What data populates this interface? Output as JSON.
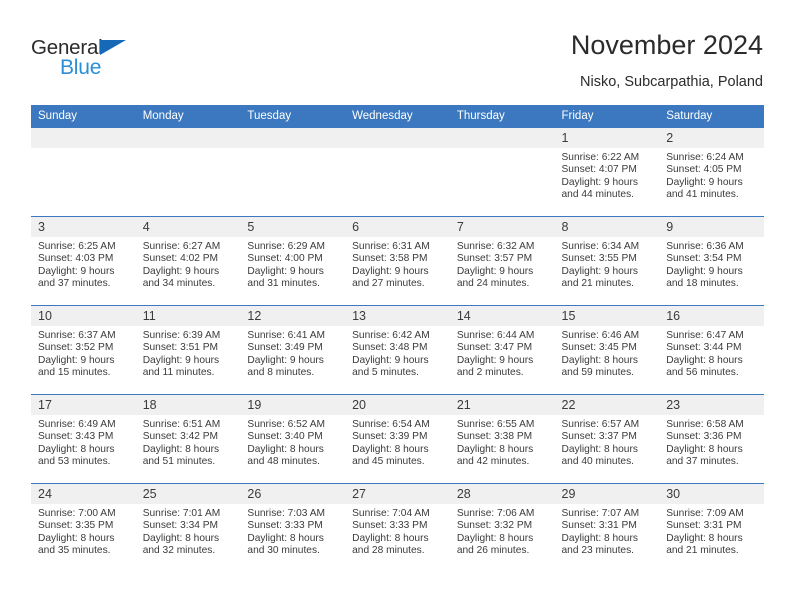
{
  "brand": {
    "word_general": "General",
    "word_blue": "Blue",
    "accent_blue": "#3b78bf",
    "logo_blue": "#2a8fd6",
    "triangle_blue": "#1669b7"
  },
  "header": {
    "title": "November 2024",
    "location": "Nisko, Subcarpathia, Poland"
  },
  "weekday_headers": [
    "Sunday",
    "Monday",
    "Tuesday",
    "Wednesday",
    "Thursday",
    "Friday",
    "Saturday"
  ],
  "weeks": [
    [
      {
        "day": "",
        "lines": []
      },
      {
        "day": "",
        "lines": []
      },
      {
        "day": "",
        "lines": []
      },
      {
        "day": "",
        "lines": []
      },
      {
        "day": "",
        "lines": []
      },
      {
        "day": "1",
        "lines": [
          "Sunrise: 6:22 AM",
          "Sunset: 4:07 PM",
          "Daylight: 9 hours",
          "and 44 minutes."
        ]
      },
      {
        "day": "2",
        "lines": [
          "Sunrise: 6:24 AM",
          "Sunset: 4:05 PM",
          "Daylight: 9 hours",
          "and 41 minutes."
        ]
      }
    ],
    [
      {
        "day": "3",
        "lines": [
          "Sunrise: 6:25 AM",
          "Sunset: 4:03 PM",
          "Daylight: 9 hours",
          "and 37 minutes."
        ]
      },
      {
        "day": "4",
        "lines": [
          "Sunrise: 6:27 AM",
          "Sunset: 4:02 PM",
          "Daylight: 9 hours",
          "and 34 minutes."
        ]
      },
      {
        "day": "5",
        "lines": [
          "Sunrise: 6:29 AM",
          "Sunset: 4:00 PM",
          "Daylight: 9 hours",
          "and 31 minutes."
        ]
      },
      {
        "day": "6",
        "lines": [
          "Sunrise: 6:31 AM",
          "Sunset: 3:58 PM",
          "Daylight: 9 hours",
          "and 27 minutes."
        ]
      },
      {
        "day": "7",
        "lines": [
          "Sunrise: 6:32 AM",
          "Sunset: 3:57 PM",
          "Daylight: 9 hours",
          "and 24 minutes."
        ]
      },
      {
        "day": "8",
        "lines": [
          "Sunrise: 6:34 AM",
          "Sunset: 3:55 PM",
          "Daylight: 9 hours",
          "and 21 minutes."
        ]
      },
      {
        "day": "9",
        "lines": [
          "Sunrise: 6:36 AM",
          "Sunset: 3:54 PM",
          "Daylight: 9 hours",
          "and 18 minutes."
        ]
      }
    ],
    [
      {
        "day": "10",
        "lines": [
          "Sunrise: 6:37 AM",
          "Sunset: 3:52 PM",
          "Daylight: 9 hours",
          "and 15 minutes."
        ]
      },
      {
        "day": "11",
        "lines": [
          "Sunrise: 6:39 AM",
          "Sunset: 3:51 PM",
          "Daylight: 9 hours",
          "and 11 minutes."
        ]
      },
      {
        "day": "12",
        "lines": [
          "Sunrise: 6:41 AM",
          "Sunset: 3:49 PM",
          "Daylight: 9 hours",
          "and 8 minutes."
        ]
      },
      {
        "day": "13",
        "lines": [
          "Sunrise: 6:42 AM",
          "Sunset: 3:48 PM",
          "Daylight: 9 hours",
          "and 5 minutes."
        ]
      },
      {
        "day": "14",
        "lines": [
          "Sunrise: 6:44 AM",
          "Sunset: 3:47 PM",
          "Daylight: 9 hours",
          "and 2 minutes."
        ]
      },
      {
        "day": "15",
        "lines": [
          "Sunrise: 6:46 AM",
          "Sunset: 3:45 PM",
          "Daylight: 8 hours",
          "and 59 minutes."
        ]
      },
      {
        "day": "16",
        "lines": [
          "Sunrise: 6:47 AM",
          "Sunset: 3:44 PM",
          "Daylight: 8 hours",
          "and 56 minutes."
        ]
      }
    ],
    [
      {
        "day": "17",
        "lines": [
          "Sunrise: 6:49 AM",
          "Sunset: 3:43 PM",
          "Daylight: 8 hours",
          "and 53 minutes."
        ]
      },
      {
        "day": "18",
        "lines": [
          "Sunrise: 6:51 AM",
          "Sunset: 3:42 PM",
          "Daylight: 8 hours",
          "and 51 minutes."
        ]
      },
      {
        "day": "19",
        "lines": [
          "Sunrise: 6:52 AM",
          "Sunset: 3:40 PM",
          "Daylight: 8 hours",
          "and 48 minutes."
        ]
      },
      {
        "day": "20",
        "lines": [
          "Sunrise: 6:54 AM",
          "Sunset: 3:39 PM",
          "Daylight: 8 hours",
          "and 45 minutes."
        ]
      },
      {
        "day": "21",
        "lines": [
          "Sunrise: 6:55 AM",
          "Sunset: 3:38 PM",
          "Daylight: 8 hours",
          "and 42 minutes."
        ]
      },
      {
        "day": "22",
        "lines": [
          "Sunrise: 6:57 AM",
          "Sunset: 3:37 PM",
          "Daylight: 8 hours",
          "and 40 minutes."
        ]
      },
      {
        "day": "23",
        "lines": [
          "Sunrise: 6:58 AM",
          "Sunset: 3:36 PM",
          "Daylight: 8 hours",
          "and 37 minutes."
        ]
      }
    ],
    [
      {
        "day": "24",
        "lines": [
          "Sunrise: 7:00 AM",
          "Sunset: 3:35 PM",
          "Daylight: 8 hours",
          "and 35 minutes."
        ]
      },
      {
        "day": "25",
        "lines": [
          "Sunrise: 7:01 AM",
          "Sunset: 3:34 PM",
          "Daylight: 8 hours",
          "and 32 minutes."
        ]
      },
      {
        "day": "26",
        "lines": [
          "Sunrise: 7:03 AM",
          "Sunset: 3:33 PM",
          "Daylight: 8 hours",
          "and 30 minutes."
        ]
      },
      {
        "day": "27",
        "lines": [
          "Sunrise: 7:04 AM",
          "Sunset: 3:33 PM",
          "Daylight: 8 hours",
          "and 28 minutes."
        ]
      },
      {
        "day": "28",
        "lines": [
          "Sunrise: 7:06 AM",
          "Sunset: 3:32 PM",
          "Daylight: 8 hours",
          "and 26 minutes."
        ]
      },
      {
        "day": "29",
        "lines": [
          "Sunrise: 7:07 AM",
          "Sunset: 3:31 PM",
          "Daylight: 8 hours",
          "and 23 minutes."
        ]
      },
      {
        "day": "30",
        "lines": [
          "Sunrise: 7:09 AM",
          "Sunset: 3:31 PM",
          "Daylight: 8 hours",
          "and 21 minutes."
        ]
      }
    ]
  ]
}
